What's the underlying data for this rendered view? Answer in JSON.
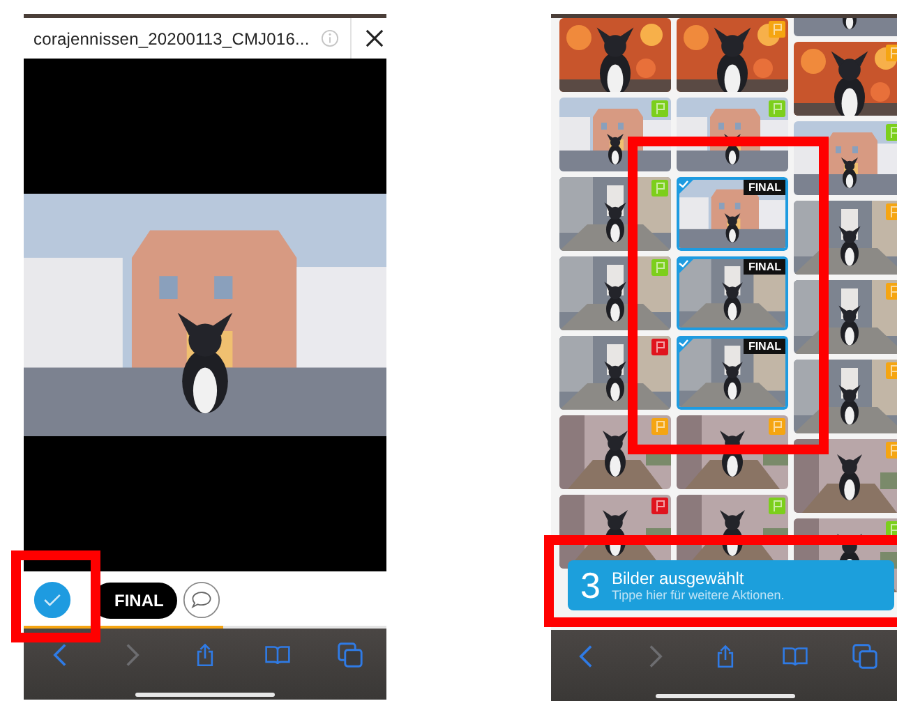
{
  "viewer": {
    "title": "corajennissen_20200113_CMJ016...",
    "picture": {
      "kind": "picture"
    },
    "selected": true,
    "final_label": "FINAL",
    "progress": {
      "level": 0.55
    },
    "toolbar": {
      "back_disabled": false,
      "forward_disabled": true
    }
  },
  "gallery": {
    "columns": [
      {
        "tiles": [
          {
            "kind": "picture",
            "selected": false
          },
          {
            "kind": "picture",
            "selected": false,
            "color": "#7ccf1c"
          },
          {
            "kind": "picture",
            "selected": false,
            "color": "#7ccf1c"
          },
          {
            "kind": "picture",
            "selected": false,
            "color": "#7ccf1c"
          },
          {
            "kind": "picture",
            "selected": false,
            "color": "#e0141e"
          },
          {
            "kind": "picture",
            "selected": false,
            "color": "#f5a512"
          },
          {
            "kind": "picture",
            "selected": false,
            "color": "#e0141e"
          }
        ]
      },
      {
        "tiles": [
          {
            "kind": "picture",
            "selected": false,
            "color": "#f5a512"
          },
          {
            "kind": "picture",
            "selected": false,
            "color": "#7ccf1c"
          },
          {
            "kind": "picture",
            "selected": true,
            "badge": "FINAL"
          },
          {
            "kind": "picture",
            "selected": true,
            "badge": "FINAL"
          },
          {
            "kind": "picture",
            "selected": true,
            "badge": "FINAL"
          },
          {
            "kind": "picture",
            "selected": false,
            "color": "#f5a512"
          },
          {
            "kind": "picture",
            "selected": false,
            "color": "#7ccf1c"
          }
        ]
      },
      {
        "tiles": [
          {
            "kind": "picture",
            "selected": false
          },
          {
            "kind": "picture",
            "selected": false,
            "color": "#f5a512"
          },
          {
            "kind": "picture",
            "selected": false,
            "color": "#7ccf1c"
          },
          {
            "kind": "picture",
            "selected": false,
            "color": "#f5a512"
          },
          {
            "kind": "picture",
            "selected": false,
            "color": "#f5a512"
          },
          {
            "kind": "picture",
            "selected": false,
            "color": "#f5a512"
          },
          {
            "kind": "picture",
            "selected": false,
            "color": "#f5a512"
          },
          {
            "kind": "picture",
            "selected": false,
            "color": "#7ccf1c"
          }
        ]
      }
    ]
  },
  "selection_toast": {
    "count": "3",
    "title": "Bilder ausgewählt",
    "hint": "Tippe hier für weitere Aktionen."
  },
  "toolbar": {
    "back_disabled": false,
    "forward_disabled": true
  }
}
